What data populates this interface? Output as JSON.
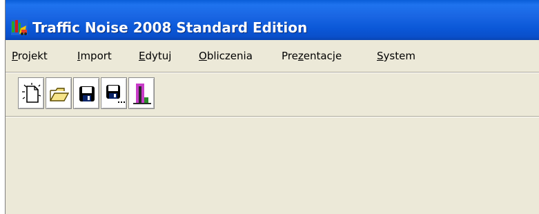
{
  "window": {
    "title": "Traffic Noise 2008 Standard Edition",
    "app_icon": "traffic-noise-app-icon"
  },
  "menu": {
    "items": [
      {
        "mnemonic": "P",
        "rest": "rojekt"
      },
      {
        "mnemonic": "I",
        "rest": "mport"
      },
      {
        "mnemonic": "E",
        "rest": "dytuj"
      },
      {
        "mnemonic": "O",
        "rest": "bliczenia"
      },
      {
        "pre": "Pre",
        "mnemonic": "z",
        "rest": "entacje"
      },
      {
        "mnemonic": "S",
        "rest": "ystem"
      }
    ]
  },
  "toolbar": {
    "buttons": [
      {
        "icon": "new-document-icon"
      },
      {
        "icon": "open-folder-icon"
      },
      {
        "icon": "save-icon"
      },
      {
        "icon": "save-as-icon"
      },
      {
        "icon": "presentation-bars-icon"
      }
    ]
  },
  "colors": {
    "titlebar": "#1a66e3",
    "window_background": "#ece9d8",
    "title_text": "#ffffff"
  }
}
